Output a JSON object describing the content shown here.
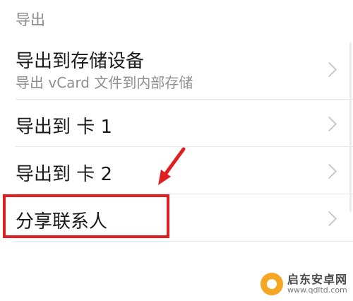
{
  "section": {
    "header": "导出"
  },
  "items": [
    {
      "title": "导出到存储设备",
      "subtitle": "导出 vCard 文件到内部存储"
    },
    {
      "title": "导出到 卡 1"
    },
    {
      "title": "导出到 卡 2"
    },
    {
      "title": "分享联系人"
    }
  ],
  "annotation": {
    "color": "#e02020"
  },
  "watermark": {
    "title": "启东安卓网",
    "url": "www.qdltd.com"
  }
}
